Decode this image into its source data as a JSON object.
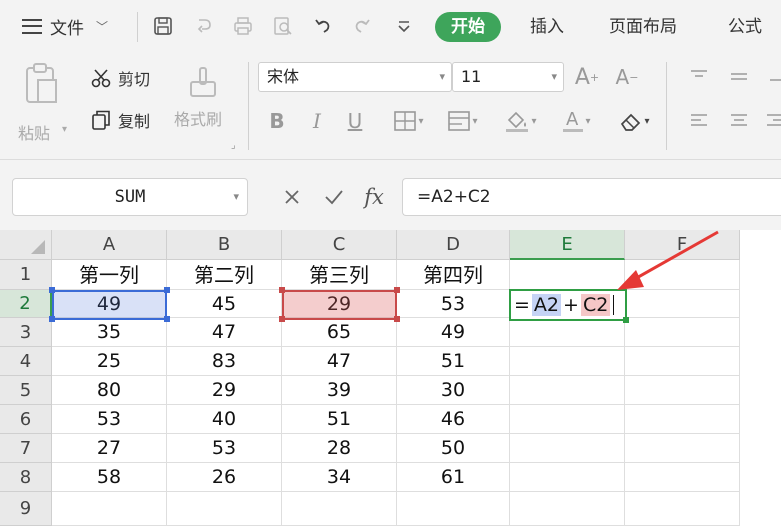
{
  "menu": {
    "label": "文件"
  },
  "tabs": [
    {
      "label": "开始",
      "active": true
    },
    {
      "label": "插入"
    },
    {
      "label": "页面布局"
    },
    {
      "label": "公式"
    }
  ],
  "clipboard": {
    "paste": "粘贴",
    "cut": "剪切",
    "copy": "复制",
    "format_painter": "格式刷"
  },
  "font": {
    "name": "宋体",
    "size": "11"
  },
  "formula_bar": {
    "name_box": "SUM",
    "fx": "fx",
    "formula": "=A2+C2"
  },
  "columns": [
    "A",
    "B",
    "C",
    "D",
    "E",
    "F"
  ],
  "rows": [
    "1",
    "2",
    "3",
    "4",
    "5",
    "6",
    "7",
    "8",
    "9"
  ],
  "cells": [
    [
      "第一列",
      "第二列",
      "第三列",
      "第四列"
    ],
    [
      "49",
      "45",
      "29",
      "53"
    ],
    [
      "35",
      "47",
      "65",
      "49"
    ],
    [
      "25",
      "83",
      "47",
      "51"
    ],
    [
      "80",
      "29",
      "39",
      "30"
    ],
    [
      "53",
      "40",
      "51",
      "46"
    ],
    [
      "27",
      "53",
      "28",
      "50"
    ],
    [
      "58",
      "26",
      "34",
      "61"
    ]
  ],
  "editing_cell": {
    "eq": "=",
    "ref1": "A2",
    "op": "+",
    "ref2": "C2"
  },
  "colors": {
    "accent_green": "#3ea55b",
    "ref_blue": "#3b6bd6",
    "ref_red": "#c84a4a",
    "arrow_red": "#e53935"
  },
  "icons": [
    "hamburger-icon",
    "save-icon",
    "undo-icon",
    "redo-icon",
    "print-icon",
    "print-preview-icon",
    "scissors-icon",
    "copy-icon",
    "paste-icon",
    "format-painter-icon",
    "bold-icon",
    "italic-icon",
    "underline-icon",
    "border-icon",
    "fill-color-icon",
    "font-color-icon",
    "eraser-icon",
    "increase-font-icon",
    "decrease-font-icon",
    "align-top-icon",
    "align-middle-icon",
    "align-left-icon",
    "align-center-icon",
    "cancel-icon",
    "confirm-icon"
  ]
}
